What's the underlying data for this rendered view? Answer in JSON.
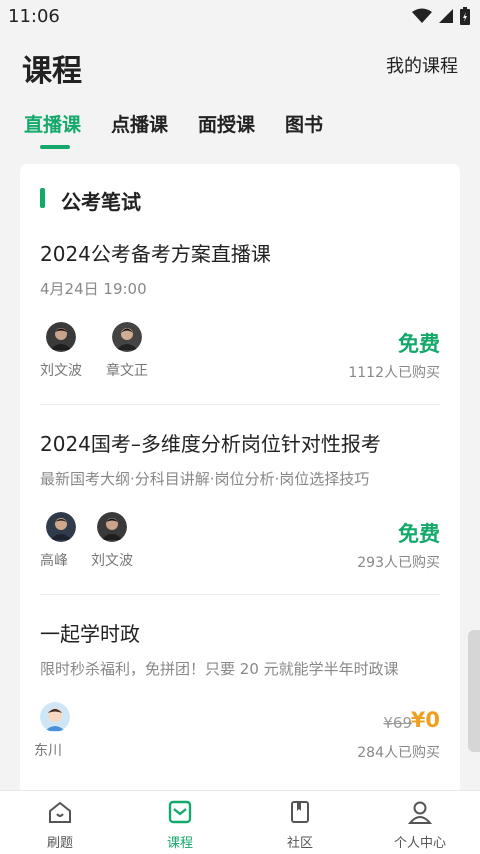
{
  "status": {
    "time": "11:06"
  },
  "header": {
    "title": "课程",
    "my_courses": "我的课程"
  },
  "tabs": [
    {
      "label": "直播课",
      "active": true
    },
    {
      "label": "点播课",
      "active": false
    },
    {
      "label": "面授课",
      "active": false
    },
    {
      "label": "图书",
      "active": false
    }
  ],
  "section": {
    "title": "公考笔试"
  },
  "courses": [
    {
      "title": "2024公考备考方案直播课",
      "subtitle": "4月24日 19:00",
      "teachers": [
        {
          "name": "刘文波"
        },
        {
          "name": "章文正"
        }
      ],
      "price": "免费",
      "buyers": "1112人已购买"
    },
    {
      "title": "2024国考–多维度分析岗位针对性报考",
      "subtitle": "最新国考大纲·分科目讲解·岗位分析·岗位选择技巧",
      "teachers": [
        {
          "name": "高峰"
        },
        {
          "name": "刘文波"
        }
      ],
      "price": "免费",
      "buyers": "293人已购买"
    },
    {
      "title": "一起学时政",
      "subtitle": "限时秒杀福利，免拼团！只要 20 元就能学半年时政课",
      "teachers": [
        {
          "name": "东川"
        }
      ],
      "old_price": "¥69",
      "price": "¥0",
      "buyers": "284人已购买"
    }
  ],
  "bottom_nav": [
    {
      "label": "刷题",
      "icon": "home-icon",
      "active": false
    },
    {
      "label": "课程",
      "icon": "course-book-icon",
      "active": true
    },
    {
      "label": "社区",
      "icon": "community-icon",
      "active": false
    },
    {
      "label": "个人中心",
      "icon": "profile-icon",
      "active": false
    }
  ],
  "colors": {
    "accent": "#13a96a",
    "price_orange": "#f0a020"
  }
}
